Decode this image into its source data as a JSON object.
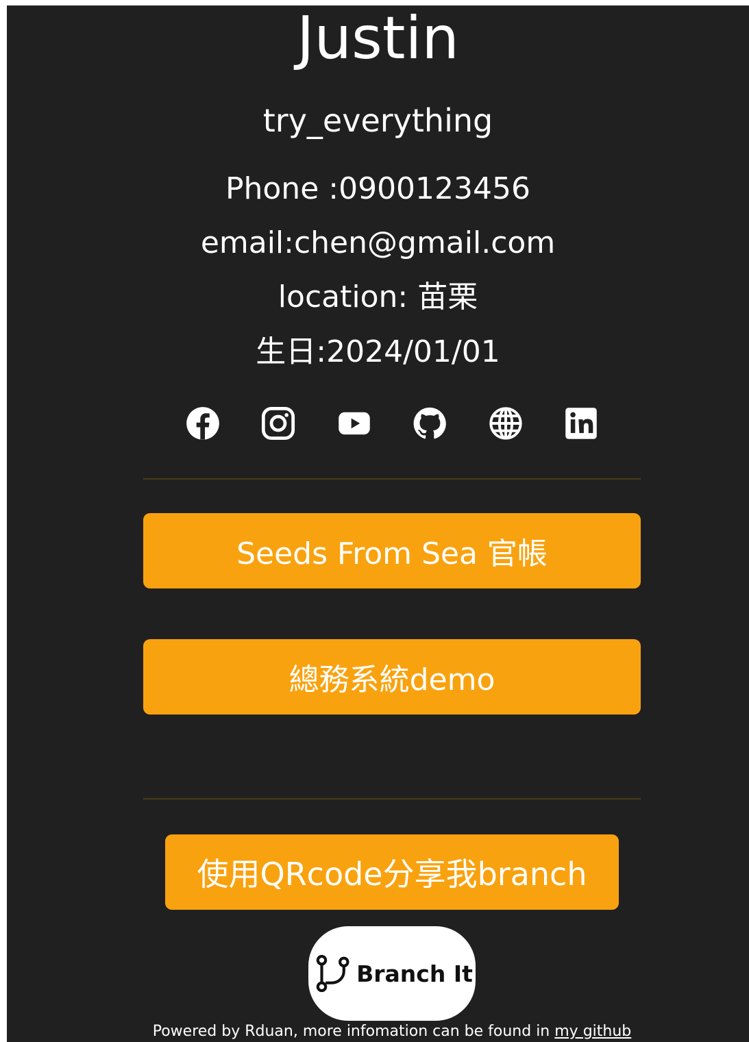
{
  "profile": {
    "name": "Justin",
    "tagline": "try_everything",
    "phone": "Phone :0900123456",
    "email": "email:chen@gmail.com",
    "location": "location: 苗栗",
    "birthday": "生日:2024/01/01"
  },
  "social_icons": [
    "facebook-icon",
    "instagram-icon",
    "youtube-icon",
    "github-icon",
    "globe-icon",
    "linkedin-icon"
  ],
  "links": {
    "seeds_from_sea": "Seeds From Sea 官帳",
    "admin_system_demo": "總務系統demo"
  },
  "share": {
    "qr_button": "使用QRcode分享我branch"
  },
  "brand": {
    "badge_text": "Branch It",
    "icon": "branch-icon"
  },
  "footer": {
    "text": "Powered by Rduan, more infomation can be found in ",
    "link_text": "my github"
  },
  "colors": {
    "background": "#202020",
    "accent": "#f9a20f",
    "divider": "#4a3a1a",
    "text": "#ffffff"
  }
}
